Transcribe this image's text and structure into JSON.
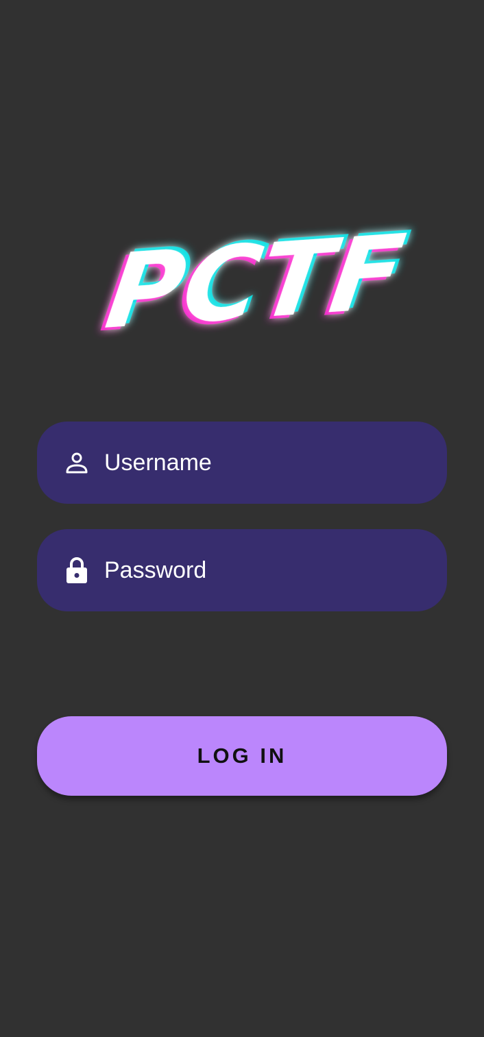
{
  "logo": {
    "text": "PCTF",
    "colors": {
      "main": "#ffffff",
      "glitch_cyan": "#00e5e8",
      "glitch_magenta": "#ff2bd6"
    }
  },
  "username": {
    "placeholder": "Username",
    "value": "",
    "icon": "person-icon"
  },
  "password": {
    "placeholder": "Password",
    "value": "",
    "icon": "lock-icon"
  },
  "login_button": {
    "label": "LOG IN"
  },
  "colors": {
    "background": "#313131",
    "field_background": "#372d6e",
    "accent": "#bb86fc",
    "text": "#ffffff"
  }
}
